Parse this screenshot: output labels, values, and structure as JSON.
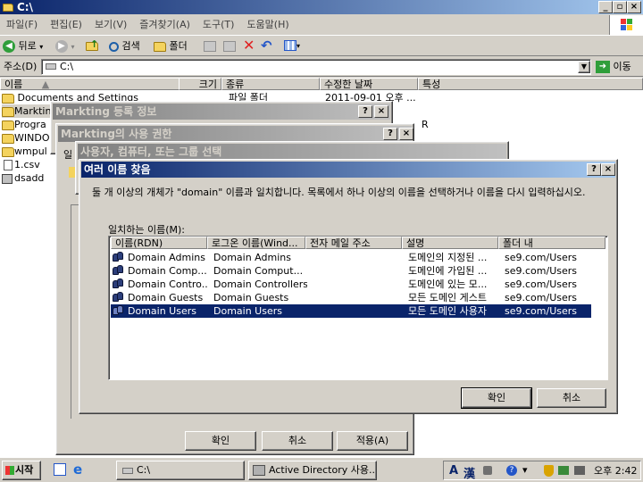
{
  "window": {
    "title": "C:\\"
  },
  "menu": [
    "파일(F)",
    "편집(E)",
    "보기(V)",
    "즐겨찾기(A)",
    "도구(T)",
    "도움말(H)"
  ],
  "toolbar": {
    "back": "뒤로",
    "search": "검색",
    "folders": "폴더"
  },
  "address": {
    "label": "주소(D)",
    "value": "C:\\",
    "go": "이동"
  },
  "explorer": {
    "columns": [
      "이름",
      "크기",
      "종류",
      "수정한 날짜",
      "특성"
    ],
    "first_row": {
      "name": "Documents and Settings",
      "type": "파일 폴더",
      "date": "2011-09-01 오후 ..."
    },
    "items": [
      "Markting",
      "Progra",
      "WINDO",
      "wmpul",
      "1.csv",
      "dsadd"
    ],
    "stray_attr": "R"
  },
  "dlg_props": {
    "title": "Markting 등록 정보",
    "help": "?",
    "close": "×"
  },
  "dlg_perm": {
    "title": "Markting의 사용 권한",
    "tab_stub": "일",
    "ok": "확인",
    "cancel": "취소",
    "apply": "적용(A)"
  },
  "dlg_select": {
    "title": "사용자, 컴퓨터, 또는 그룹 선택"
  },
  "dlg_multi": {
    "title": "여러 이름 찾음",
    "message": "둘 개 이상의 개체가 \"domain\" 이름과 일치합니다. 목록에서 하나 이상의 이름을 선택하거나 이름을 다시 입력하십시오.",
    "list_label": "일치하는 이름(M):",
    "columns": [
      "이름(RDN)",
      "로그온 이름(Wind...",
      "전자 메일 주소",
      "설명",
      "폴더 내"
    ],
    "rows": [
      {
        "name": "Domain Admins",
        "logon": "Domain Admins",
        "email": "",
        "desc": "도메인의 지정된 ...",
        "folder": "se9.com/Users"
      },
      {
        "name": "Domain Comp...",
        "logon": "Domain Comput...",
        "email": "",
        "desc": "도메인에 가입된 ...",
        "folder": "se9.com/Users"
      },
      {
        "name": "Domain Contro...",
        "logon": "Domain Controllers",
        "email": "",
        "desc": "도메인에 있는 모...",
        "folder": "se9.com/Users"
      },
      {
        "name": "Domain Guests",
        "logon": "Domain Guests",
        "email": "",
        "desc": "모든 도메인 게스트",
        "folder": "se9.com/Users"
      },
      {
        "name": "Domain Users",
        "logon": "Domain Users",
        "email": "",
        "desc": "모든 도메인 사용자",
        "folder": "se9.com/Users"
      }
    ],
    "selected_index": 4,
    "ok": "확인",
    "cancel": "취소"
  },
  "taskbar": {
    "start": "시작",
    "tasks": [
      "C:\\",
      "Active Directory 사용..."
    ],
    "tray": {
      "lang1": "A",
      "lang2": "漢",
      "time": "오후 2:42"
    }
  }
}
